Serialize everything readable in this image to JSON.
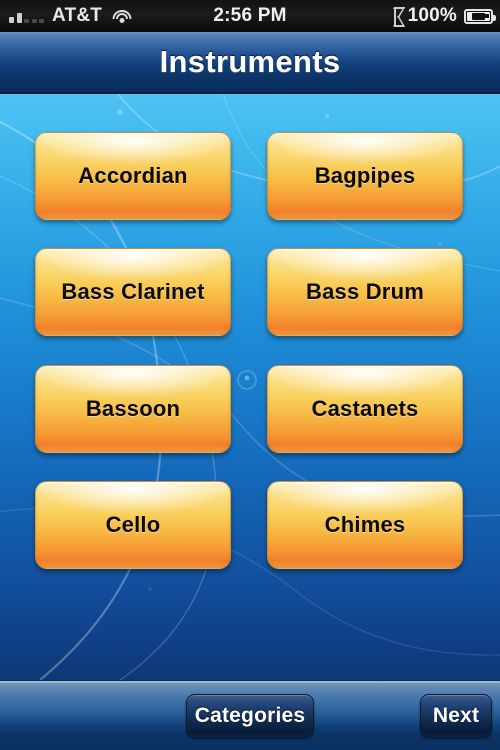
{
  "status_bar": {
    "signal_icon": "signal-bars-icon",
    "signal_bars_filled": 2,
    "signal_bars_total": 5,
    "carrier": "AT&T",
    "wifi_icon": "wifi-icon",
    "time": "2:56 PM",
    "bluetooth_icon": "bluetooth-icon",
    "battery_percent": "100%",
    "battery_icon": "battery-charging-icon"
  },
  "nav_bar": {
    "title": "Instruments"
  },
  "grid": {
    "items": [
      {
        "label": "Accordian"
      },
      {
        "label": "Bagpipes"
      },
      {
        "label": "Bass Clarinet"
      },
      {
        "label": "Bass Drum"
      },
      {
        "label": "Bassoon"
      },
      {
        "label": "Castanets"
      },
      {
        "label": "Cello"
      },
      {
        "label": "Chimes"
      }
    ]
  },
  "toolbar": {
    "categories_label": "Categories",
    "next_label": "Next"
  },
  "colors": {
    "nav_bar_blue": "#13417c",
    "background_top": "#4fc3f2",
    "background_bottom": "#0d3877",
    "tile_gold_top": "#fdf0c0",
    "tile_orange_bottom": "#f37f2c",
    "toolbar_dark": "#093262",
    "status_bar_black": "#121212"
  }
}
